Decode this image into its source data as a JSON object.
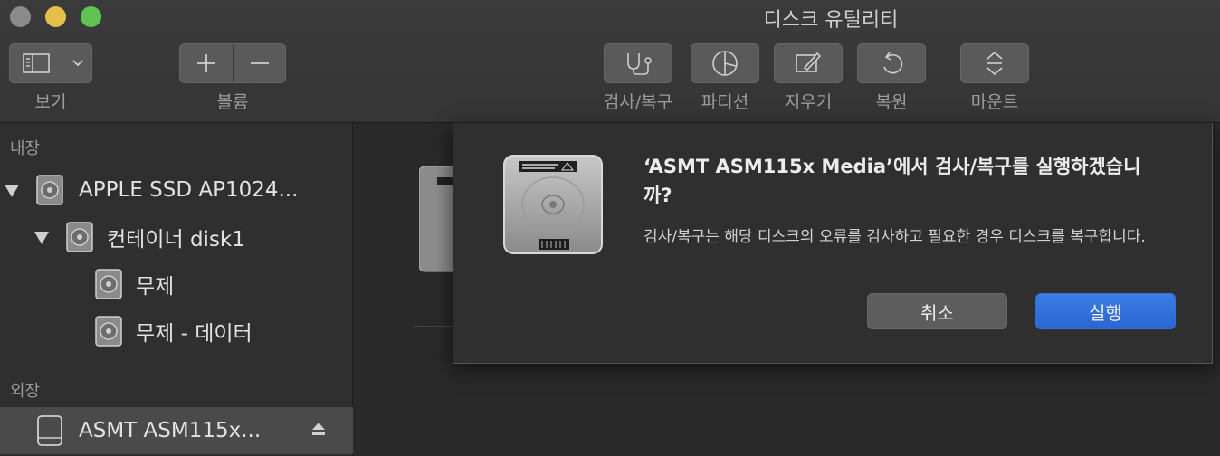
{
  "window": {
    "title": "디스크 유틸리티"
  },
  "toolbar": {
    "view_label": "보기",
    "volume_label": "볼륨",
    "firstaid_label": "검사/복구",
    "partition_label": "파티션",
    "erase_label": "지우기",
    "restore_label": "복원",
    "mount_label": "마운트"
  },
  "sidebar": {
    "internal_header": "내장",
    "external_header": "외장",
    "items": [
      {
        "label": "APPLE SSD AP1024..."
      },
      {
        "label": "컨테이너 disk1"
      },
      {
        "label": "무제"
      },
      {
        "label": "무제 - 데이터"
      },
      {
        "label": "ASMT ASM115x..."
      }
    ]
  },
  "dialog": {
    "title": "‘ASMT ASM115x Media’에서 검사/복구를 실행하겠습니까?",
    "body": "검사/복구는 해당 디스크의 오류를 검사하고 필요한 경우 디스크를 복구합니다.",
    "cancel_label": "취소",
    "run_label": "실행"
  },
  "colors": {
    "accent": "#2a66d1"
  }
}
